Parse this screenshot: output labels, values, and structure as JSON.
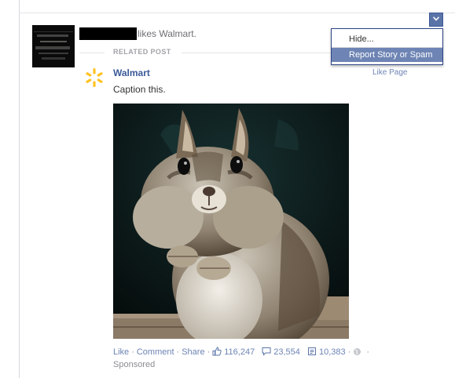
{
  "story": {
    "actor_text": "likes Walmart.",
    "related_label": "RELATED POST"
  },
  "post": {
    "page_name": "Walmart",
    "caption": "Caption this.",
    "photo_subject": "chipmunk photo"
  },
  "footer": {
    "like": "Like",
    "comment": "Comment",
    "share": "Share",
    "likes_count": "116,247",
    "comments_count": "23,554",
    "shares_count": "10,383",
    "sponsored": "Sponsored"
  },
  "menu": {
    "hide": "Hide...",
    "report": "Report Story or Spam"
  },
  "like_page": "Like Page",
  "icons": {
    "dropdown": "chevron-down-icon",
    "logo": "walmart-spark-icon",
    "likes": "thumbs-up-icon",
    "comments": "comment-icon",
    "shares": "share-icon",
    "privacy": "globe-icon"
  },
  "colors": {
    "link": "#3b5998",
    "menu_highlight": "#6d84b4",
    "logo_yellow": "#ffc220"
  }
}
